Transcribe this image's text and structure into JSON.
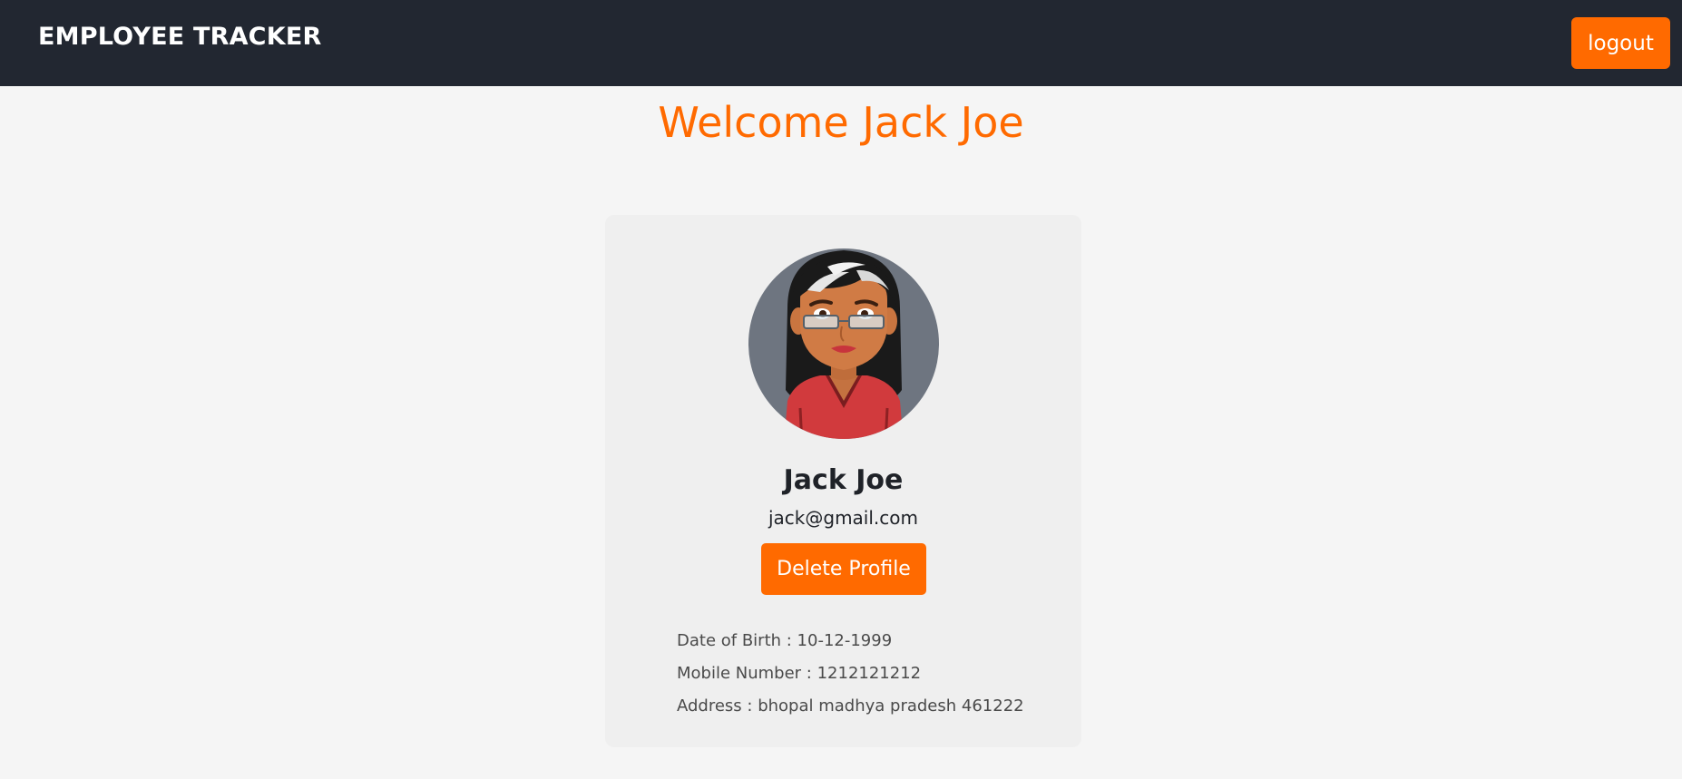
{
  "navbar": {
    "brand": "EMPLOYEE TRACKER",
    "logout_label": "logout"
  },
  "page": {
    "welcome": "Welcome Jack Joe"
  },
  "profile": {
    "avatar_icon": "woman-with-glasses-avatar",
    "name": "Jack Joe",
    "email": "jack@gmail.com",
    "delete_label": "Delete Profile",
    "details": [
      "Date of Birth : 10-12-1999",
      "Mobile Number : 1212121212",
      "Address : bhopal madhya pradesh 461222"
    ]
  },
  "colors": {
    "accent": "#ff6a00",
    "navbar": "#222731",
    "background": "#f5f5f5",
    "card": "#efefef"
  }
}
